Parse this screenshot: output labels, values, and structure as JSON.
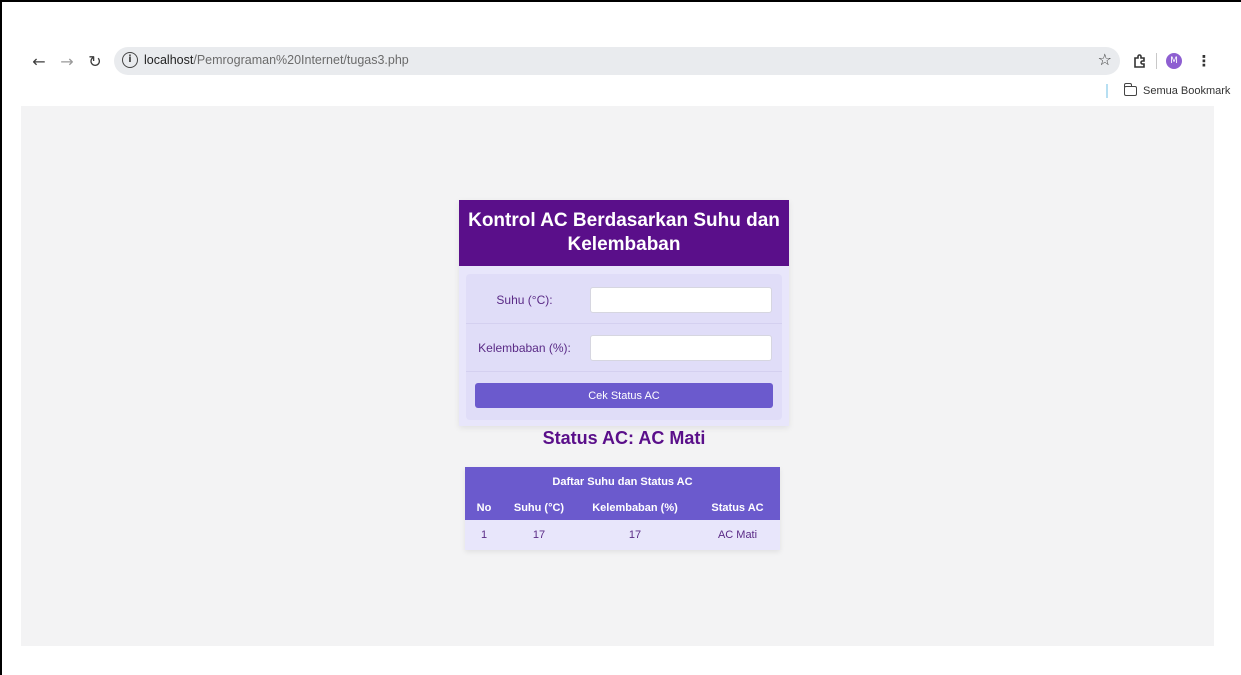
{
  "browser": {
    "url_host": "localhost",
    "url_path": "/Pemrograman%20Internet/tugas3.php",
    "avatar_letter": "M",
    "bookmarks_label": "Semua Bookmark"
  },
  "card": {
    "title": "Kontrol AC Berdasarkan Suhu dan Kelembaban",
    "suhu_label": "Suhu (°C):",
    "suhu_value": "",
    "kelembaban_label": "Kelembaban (%):",
    "kelembaban_value": "",
    "button_label": "Cek Status AC"
  },
  "status_text": "Status AC: AC Mati",
  "table": {
    "caption": "Daftar Suhu dan Status AC",
    "headers": [
      "No",
      "Suhu (°C)",
      "Kelembaban (%)",
      "Status AC"
    ],
    "rows": [
      [
        "1",
        "17",
        "17",
        "AC Mati"
      ]
    ]
  },
  "colors": {
    "header_purple": "#5a0f8a",
    "accent": "#6b5acd",
    "card_bg": "#e8e6fb",
    "page_bg": "#f3f3f4"
  },
  "icons": [
    "back-arrow-icon",
    "forward-arrow-icon",
    "reload-icon",
    "info-icon",
    "star-icon",
    "extensions-icon",
    "kebab-menu-icon",
    "folder-icon"
  ]
}
